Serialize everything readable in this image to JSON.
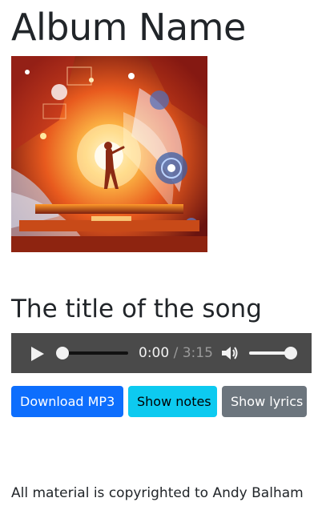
{
  "album": {
    "title": "Album Name"
  },
  "cover": {
    "icon": "album-cover-art"
  },
  "song": {
    "title": "The title of the song"
  },
  "player": {
    "current_time": "0:00",
    "separator": "/",
    "duration": "3:15",
    "progress": 0,
    "volume": 1.0,
    "colors": {
      "background": "#4a4a4a",
      "text": "#f2f2f2",
      "muted": "#9a9a9a"
    }
  },
  "buttons": {
    "download": "Download MP3",
    "notes": "Show notes",
    "lyrics": "Show lyrics",
    "colors": {
      "primary": "#0d6efd",
      "info": "#0dcaf0",
      "secondary": "#6c757d"
    }
  },
  "footer": {
    "text": "All material is copyrighted to Andy Balham"
  }
}
